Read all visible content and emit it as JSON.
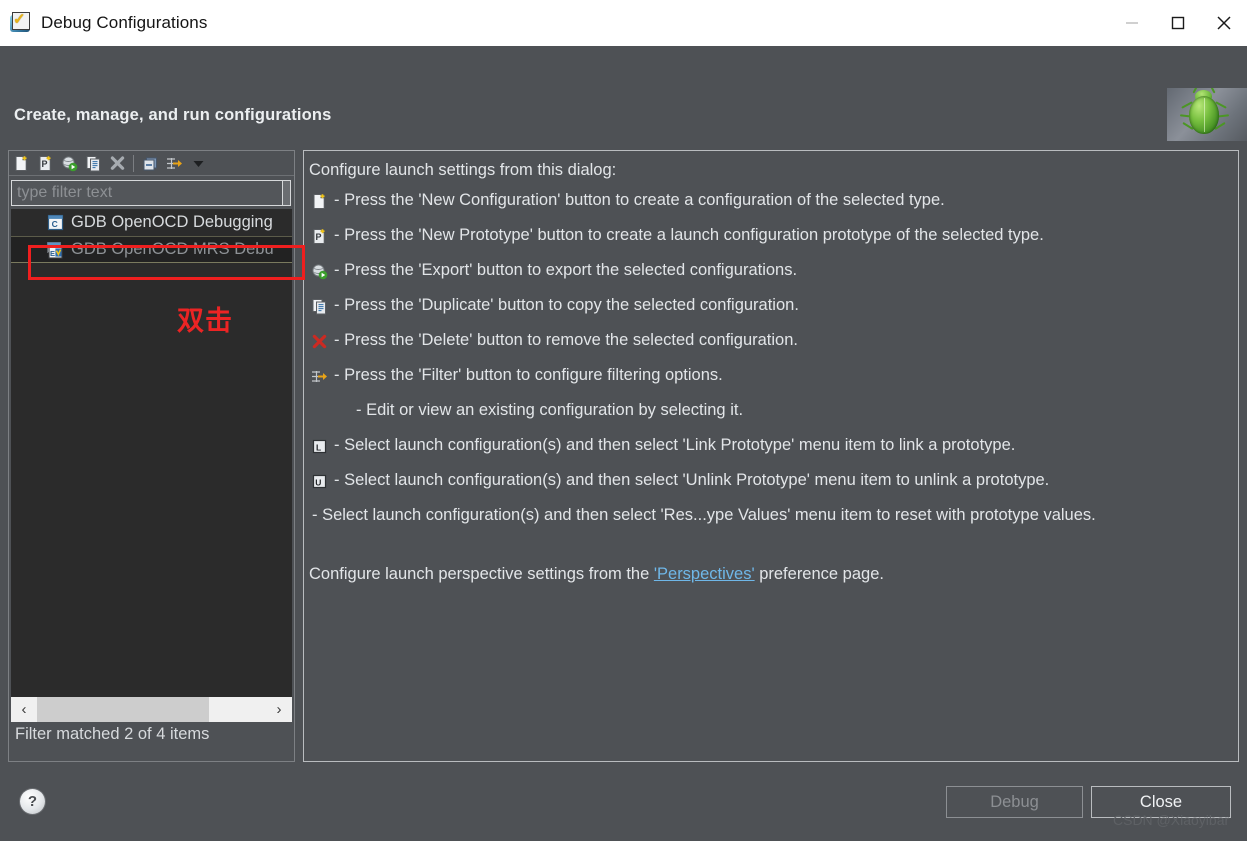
{
  "window": {
    "title": "Debug Configurations",
    "icon": "launch-config-icon",
    "controls": [
      {
        "name": "minimize-button",
        "glyph": "minimize"
      },
      {
        "name": "maximize-button",
        "glyph": "maximize"
      },
      {
        "name": "close-button",
        "glyph": "close"
      }
    ]
  },
  "header": {
    "title": "Create, manage, and run configurations",
    "icon": "bug-icon"
  },
  "toolbar": {
    "buttons": [
      {
        "name": "new-configuration-button",
        "icon": "new-config-icon",
        "tooltip": "New Configuration"
      },
      {
        "name": "new-prototype-button",
        "icon": "new-prototype-icon",
        "tooltip": "New Prototype"
      },
      {
        "name": "export-button",
        "icon": "export-icon",
        "tooltip": "Export"
      },
      {
        "name": "duplicate-button",
        "icon": "duplicate-icon",
        "tooltip": "Duplicate"
      },
      {
        "name": "delete-button",
        "icon": "delete-icon",
        "tooltip": "Delete"
      },
      {
        "name": "collapse-all-button",
        "icon": "collapse-all-icon",
        "tooltip": "Collapse All"
      },
      {
        "name": "filter-button",
        "icon": "filter-icon",
        "tooltip": "Filter"
      },
      {
        "name": "view-menu-button",
        "icon": "chevron-down-icon",
        "tooltip": "View Menu"
      }
    ]
  },
  "filter": {
    "placeholder": "type filter text",
    "value": "",
    "status": "Filter matched 2 of 4 items"
  },
  "tree": {
    "items": [
      {
        "label": "GDB OpenOCD Debugging",
        "icon": "c-config-icon",
        "selected": false
      },
      {
        "label": "GDB OpenOCD MRS Debu",
        "icon": "mrs-config-icon",
        "selected": true
      }
    ]
  },
  "scrollbar": {
    "left_arrow": "‹",
    "right_arrow": "›"
  },
  "info": {
    "heading": "Configure launch settings from this dialog:",
    "rows": [
      {
        "icon": "new-config-icon",
        "text": "- Press the 'New Configuration' button to create a configuration of the selected type."
      },
      {
        "icon": "new-prototype-icon",
        "text": "- Press the 'New Prototype' button to create a launch configuration prototype of the selected type."
      },
      {
        "icon": "export-icon",
        "text": "- Press the 'Export' button to export the selected configurations."
      },
      {
        "icon": "duplicate-icon",
        "text": "- Press the 'Duplicate' button to copy the selected configuration."
      },
      {
        "icon": "delete-icon",
        "text": "- Press the 'Delete' button to remove the selected configuration."
      },
      {
        "icon": "filter-icon",
        "text": "- Press the 'Filter' button to configure filtering options."
      },
      {
        "icon": "none",
        "text": "- Edit or view an existing configuration by selecting it."
      },
      {
        "icon": "link-prototype-icon",
        "text": "- Select launch configuration(s) and then select 'Link Prototype' menu item to link a prototype."
      },
      {
        "icon": "unlink-prototype-icon",
        "text": "- Select launch configuration(s) and then select 'Unlink Prototype' menu item to unlink a prototype."
      },
      {
        "icon": "none-flush",
        "text": "- Select launch configuration(s) and then select 'Res...ype Values' menu item to reset with prototype values."
      }
    ],
    "footer_before": "Configure launch perspective settings from the ",
    "footer_link": "'Perspectives'",
    "footer_after": " preference page."
  },
  "footer": {
    "help_glyph": "?",
    "debug_label": "Debug",
    "close_label": "Close"
  },
  "annotations": {
    "double_click_text": "双击",
    "highlight_color": "#ef1f1f"
  },
  "watermark": "CSDN @Xiaoyibar"
}
